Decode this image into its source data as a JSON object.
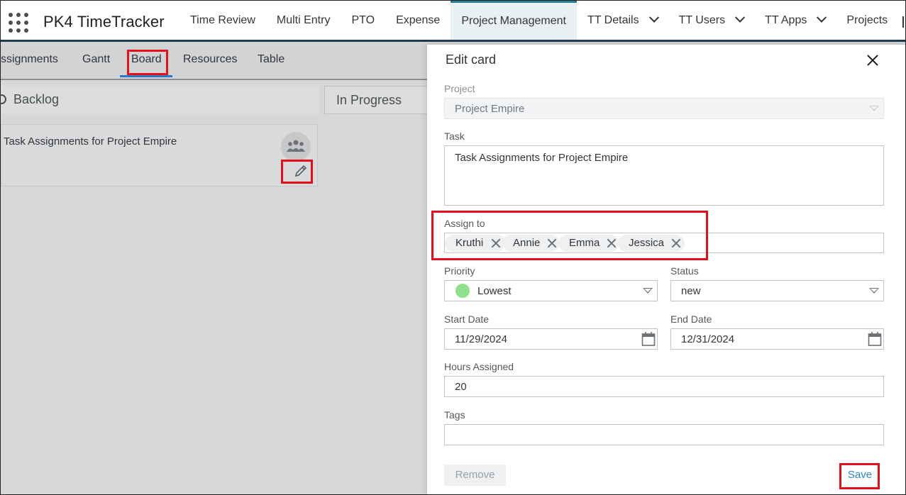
{
  "app": {
    "title": "PK4 TimeTracker"
  },
  "nav": {
    "items": [
      {
        "label": "Time Review"
      },
      {
        "label": "Multi Entry"
      },
      {
        "label": "PTO"
      },
      {
        "label": "Expense"
      },
      {
        "label": "Project Management"
      },
      {
        "label": "TT Details"
      },
      {
        "label": "TT Users"
      },
      {
        "label": "TT Apps"
      },
      {
        "label": "Projects"
      }
    ]
  },
  "subtabs": [
    "ssignments",
    "Gantt",
    "Board",
    "Resources",
    "Table"
  ],
  "board": {
    "lanes": [
      "Backlog",
      "In Progress"
    ],
    "card": {
      "title": "Task Assignments for Project Empire"
    }
  },
  "panel": {
    "title": "Edit card",
    "project": {
      "label": "Project",
      "value": "Project Empire"
    },
    "task": {
      "label": "Task",
      "value": "Task Assignments for Project Empire"
    },
    "assign": {
      "label": "Assign to",
      "people": [
        "Kruthi",
        "Annie",
        "Emma",
        "Jessica"
      ]
    },
    "priority": {
      "label": "Priority",
      "value": "Lowest",
      "color": "#8ee08a"
    },
    "status": {
      "label": "Status",
      "value": "new"
    },
    "start_date": {
      "label": "Start Date",
      "value": "11/29/2024"
    },
    "end_date": {
      "label": "End Date",
      "value": "12/31/2024"
    },
    "hours": {
      "label": "Hours Assigned",
      "value": "20"
    },
    "tags": {
      "label": "Tags",
      "value": ""
    },
    "remove_label": "Remove",
    "save_label": "Save"
  },
  "colors": {
    "highlight": "#e3101c",
    "accent": "#2b7c96",
    "link": "#2b87c4"
  }
}
